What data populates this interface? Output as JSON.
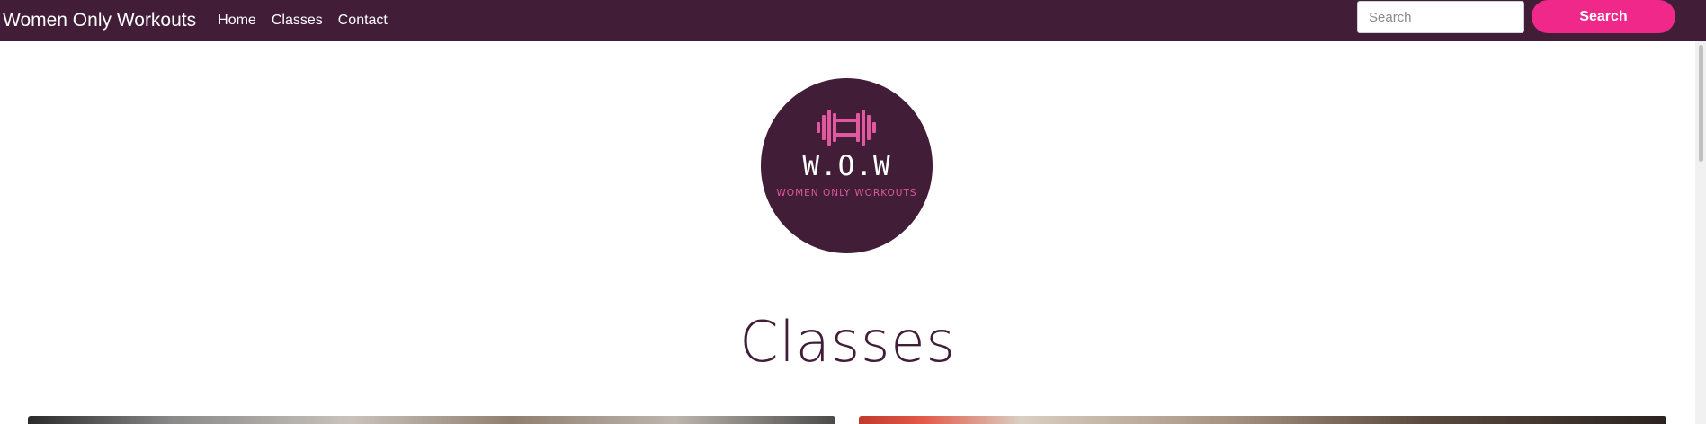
{
  "navbar": {
    "brand": "Women Only Workouts",
    "links": [
      {
        "label": "Home"
      },
      {
        "label": "Classes"
      },
      {
        "label": "Contact"
      }
    ],
    "search": {
      "placeholder": "Search",
      "value": ""
    },
    "search_button_label": "Search",
    "background_color": "#421d38",
    "accent_color": "#f0288a"
  },
  "logo": {
    "title": "W.O.W",
    "subtitle": "WOMEN ONLY WORKOUTS",
    "icon": "dumbbell-icon",
    "text_color": "#e0589e"
  },
  "main": {
    "section_title": "Classes"
  }
}
